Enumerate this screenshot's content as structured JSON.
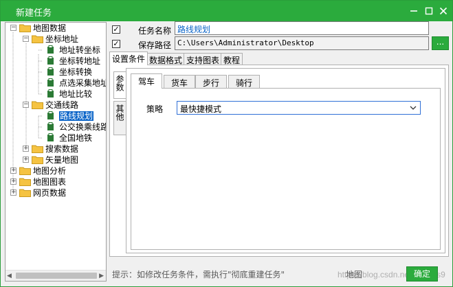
{
  "window": {
    "title": "新建任务"
  },
  "tree": {
    "nodes": [
      {
        "label": "地图数据",
        "expander": "−"
      },
      {
        "label": "坐标地址",
        "expander": "−"
      },
      {
        "label": "地址转坐标"
      },
      {
        "label": "坐标转地址"
      },
      {
        "label": "坐标转换"
      },
      {
        "label": "点选采集地址"
      },
      {
        "label": "地址比较"
      },
      {
        "label": "交通线路",
        "expander": "−"
      },
      {
        "label": "路线规划",
        "selected": true
      },
      {
        "label": "公交换乘线路"
      },
      {
        "label": "全国地铁"
      },
      {
        "label": "搜索数据",
        "expander": "+"
      },
      {
        "label": "矢量地图",
        "expander": "+"
      },
      {
        "label": "地图分析",
        "expander": "+"
      },
      {
        "label": "地图图表",
        "expander": "+"
      },
      {
        "label": "网页数据",
        "expander": "+"
      }
    ]
  },
  "form": {
    "task_name_label": "任务名称",
    "task_name_value": "路线规划",
    "save_path_label": "保存路径",
    "save_path_value": "C:\\Users\\Administrator\\Desktop",
    "browse_label": "..."
  },
  "outer_tabs": [
    "设置条件",
    "数据格式",
    "支持图表",
    "教程"
  ],
  "side_tabs": [
    "参数",
    "其他"
  ],
  "mode_tabs": [
    "驾车",
    "货车",
    "步行",
    "骑行"
  ],
  "strategy": {
    "label": "策略",
    "value": "最快捷模式"
  },
  "footer": {
    "hint": "提示：如修改任务条件，需执行\"彻底重建任务\"",
    "map_label": "地图",
    "ok_label": "确定",
    "watermark": "https://blog.csdn.net/xxxxgis9"
  },
  "colors": {
    "accent": "#2bab3d",
    "selection": "#0a64c8",
    "folder": "#f5c342"
  }
}
